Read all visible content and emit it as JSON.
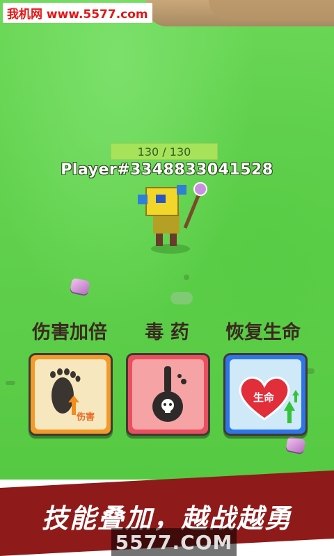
{
  "watermark": "我机网 www.5577.com",
  "player": {
    "hp_text": "130 / 130",
    "name": "Player#3348833041528"
  },
  "skills": [
    {
      "title": "伤害加倍",
      "icon": "footprint-damage-icon",
      "tag": "伤害"
    },
    {
      "title": "毒 药",
      "icon": "poison-flask-icon"
    },
    {
      "title": "恢复生命",
      "icon": "heart-life-icon",
      "tag": "生命"
    }
  ],
  "banner": {
    "slogan": "技能叠加，越战越勇",
    "site": "5577.COM"
  },
  "colors": {
    "grass": "#5fd44a",
    "banner_red": "#8f1a1a",
    "card_orange": "#f29a2a",
    "card_red": "#e85060",
    "card_blue": "#2e76e8"
  }
}
